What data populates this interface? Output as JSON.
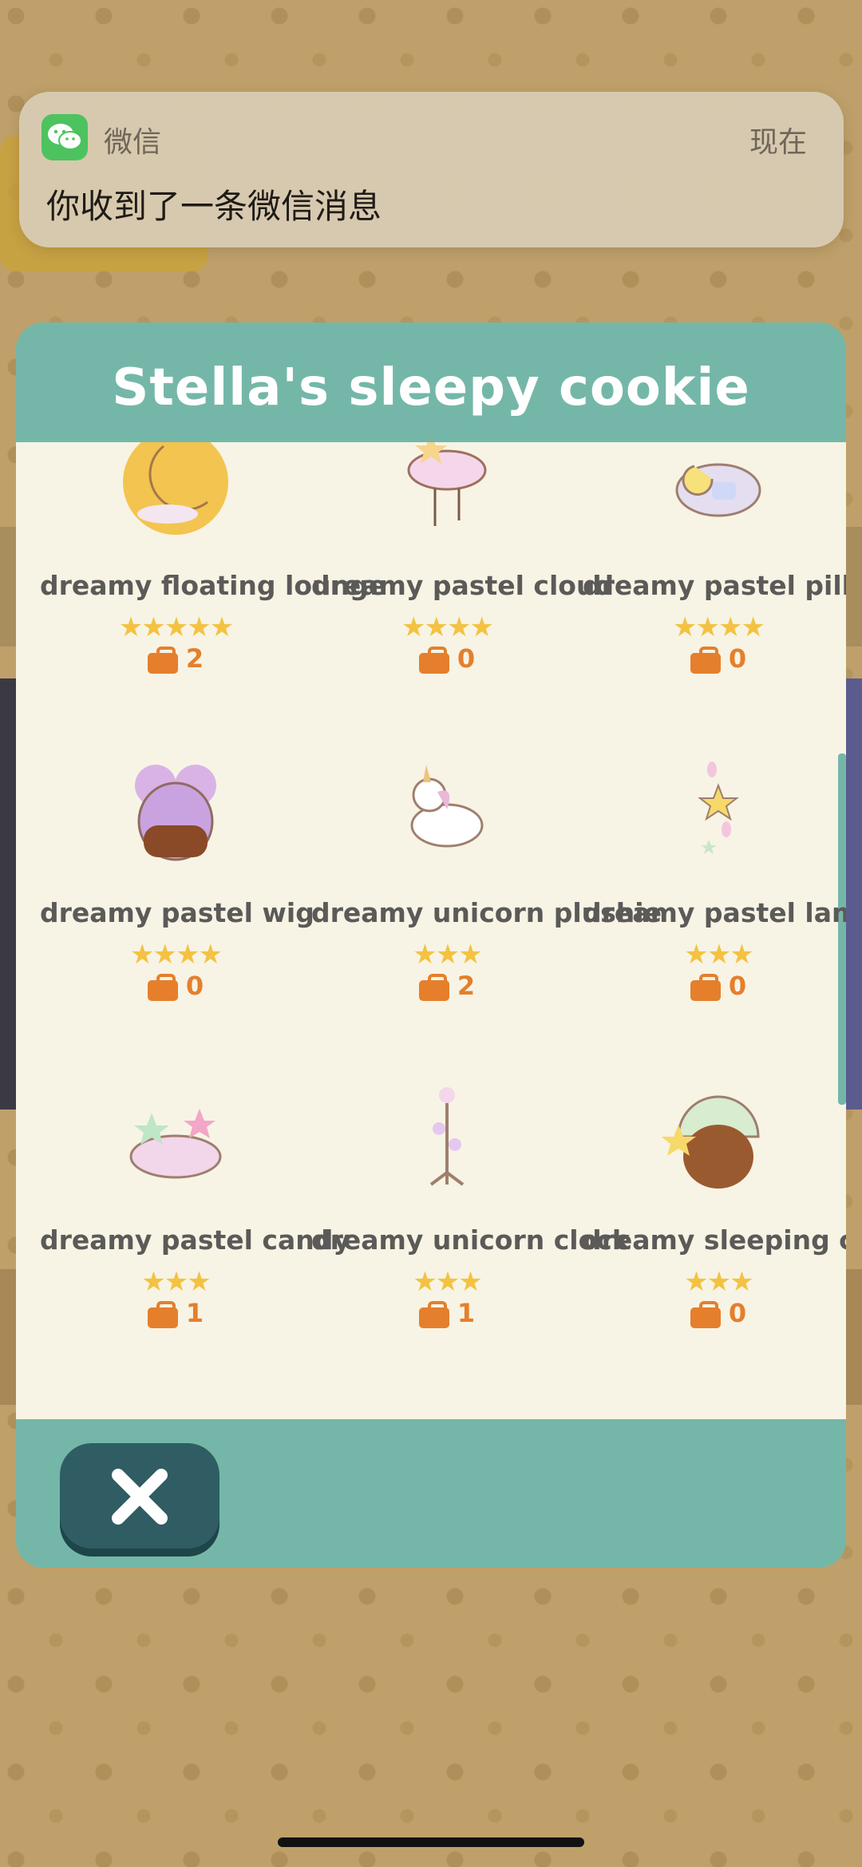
{
  "notification": {
    "app_name": "微信",
    "time": "现在",
    "message": "你收到了一条微信消息",
    "icon": "wechat-icon"
  },
  "modal": {
    "title": "Stella's sleepy cookie",
    "close_icon": "close-icon",
    "items": [
      {
        "name": "dreamy floating lounge",
        "stars": "★★★★★",
        "rating": 5,
        "count": "2"
      },
      {
        "name": "dreamy pastel cloud",
        "stars": "★★★★",
        "rating": 4,
        "count": "0"
      },
      {
        "name": "dreamy pastel pillows",
        "stars": "★★★★",
        "rating": 4,
        "count": "0"
      },
      {
        "name": "dreamy pastel wig",
        "stars": "★★★★",
        "rating": 4,
        "count": "0"
      },
      {
        "name": "dreamy unicorn plushie",
        "stars": "★★★",
        "rating": 3,
        "count": "2"
      },
      {
        "name": "dreamy pastel lamp",
        "stars": "★★★",
        "rating": 3,
        "count": "0"
      },
      {
        "name": "dreamy pastel candy",
        "stars": "★★★",
        "rating": 3,
        "count": "1"
      },
      {
        "name": "dreamy unicorn clock",
        "stars": "★★★",
        "rating": 3,
        "count": "1"
      },
      {
        "name": "dreamy sleeping cap",
        "stars": "★★★",
        "rating": 3,
        "count": "0"
      }
    ]
  },
  "colors": {
    "teal": "#74b7a8",
    "cream": "#f7f4e5",
    "star": "#f4c242",
    "orange": "#e57f2c",
    "close_button": "#2f5d63"
  }
}
